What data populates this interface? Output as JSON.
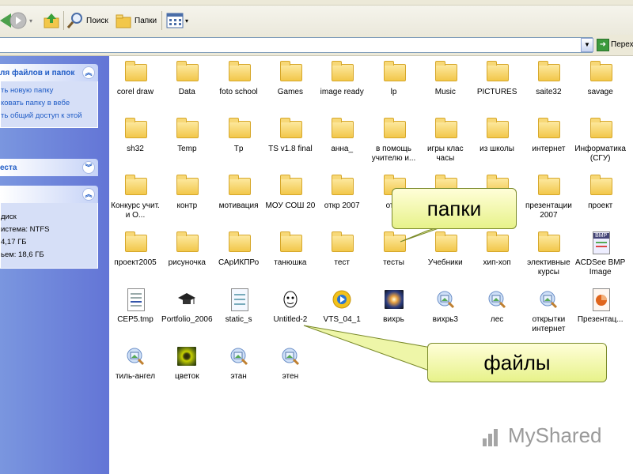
{
  "toolbar": {
    "search_label": "Поиск",
    "folders_label": "Папки"
  },
  "address": {
    "go_label": "Перех"
  },
  "tasks_panel": {
    "title": "ля файлов и папок",
    "items": [
      "ть новую папку",
      "ковать папку в вебе",
      "ть общий доступ к этой"
    ]
  },
  "places_panel": {
    "title": "еста"
  },
  "details_panel": {
    "title": "",
    "lines": [
      "диск",
      "истема: NTFS",
      "4,17 ГБ",
      "ьем: 18,6 ГБ"
    ]
  },
  "items": [
    {
      "label": "corel draw",
      "type": "folder"
    },
    {
      "label": "Data",
      "type": "folder"
    },
    {
      "label": "foto school",
      "type": "folder"
    },
    {
      "label": "Games",
      "type": "folder"
    },
    {
      "label": "image ready",
      "type": "folder"
    },
    {
      "label": "lp",
      "type": "folder"
    },
    {
      "label": "Music",
      "type": "folder"
    },
    {
      "label": "PICTURES",
      "type": "folder"
    },
    {
      "label": "saite32",
      "type": "folder"
    },
    {
      "label": "savage",
      "type": "folder"
    },
    {
      "label": "sh32",
      "type": "folder"
    },
    {
      "label": "Temp",
      "type": "folder"
    },
    {
      "label": "Tp",
      "type": "folder"
    },
    {
      "label": "TS v1.8 final",
      "type": "folder"
    },
    {
      "label": "анна_",
      "type": "folder"
    },
    {
      "label": "в помощь учителю и...",
      "type": "folder"
    },
    {
      "label": "игры клас часы",
      "type": "folder"
    },
    {
      "label": "из школы",
      "type": "folder"
    },
    {
      "label": "интернет",
      "type": "folder"
    },
    {
      "label": "Информатика (СГУ)",
      "type": "folder"
    },
    {
      "label": "Конкурс учит. и О...",
      "type": "folder"
    },
    {
      "label": "контр",
      "type": "folder"
    },
    {
      "label": "мотивация",
      "type": "folder"
    },
    {
      "label": "МОУ СОШ 20",
      "type": "folder"
    },
    {
      "label": "откр 2007",
      "type": "folder"
    },
    {
      "label": "откр",
      "type": "folder"
    },
    {
      "label": "",
      "type": "folder"
    },
    {
      "label": "",
      "type": "folder"
    },
    {
      "label": "презентации 2007",
      "type": "folder"
    },
    {
      "label": "проект",
      "type": "folder"
    },
    {
      "label": "проект2005",
      "type": "folder"
    },
    {
      "label": "рисуночка",
      "type": "folder"
    },
    {
      "label": "САрИКПРо",
      "type": "folder"
    },
    {
      "label": "танюшка",
      "type": "folder"
    },
    {
      "label": "тест",
      "type": "folder"
    },
    {
      "label": "тесты",
      "type": "folder"
    },
    {
      "label": "Учебники",
      "type": "folder"
    },
    {
      "label": "хип-хоп",
      "type": "folder"
    },
    {
      "label": "элективные курсы",
      "type": "folder"
    },
    {
      "label": "ACDSee BMP Image",
      "type": "bmp"
    },
    {
      "label": "CEP5.tmp",
      "type": "tmp"
    },
    {
      "label": "Portfolio_2006",
      "type": "cap"
    },
    {
      "label": "static_s",
      "type": "doc"
    },
    {
      "label": "Untitled-2",
      "type": "face"
    },
    {
      "label": "VTS_04_1",
      "type": "cd"
    },
    {
      "label": "вихрь",
      "type": "photo"
    },
    {
      "label": "вихрь3",
      "type": "pic"
    },
    {
      "label": "лес",
      "type": "pic"
    },
    {
      "label": "открытки интернет",
      "type": "pic"
    },
    {
      "label": "Презентац...",
      "type": "ppt"
    },
    {
      "label": "тиль-ангел",
      "type": "pic"
    },
    {
      "label": "цветок",
      "type": "flower"
    },
    {
      "label": "этан",
      "type": "pic"
    },
    {
      "label": "этен",
      "type": "pic"
    }
  ],
  "callouts": {
    "folders": "папки",
    "files": "файлы"
  },
  "bmp_badge": "BMP",
  "watermark": "MyShared"
}
